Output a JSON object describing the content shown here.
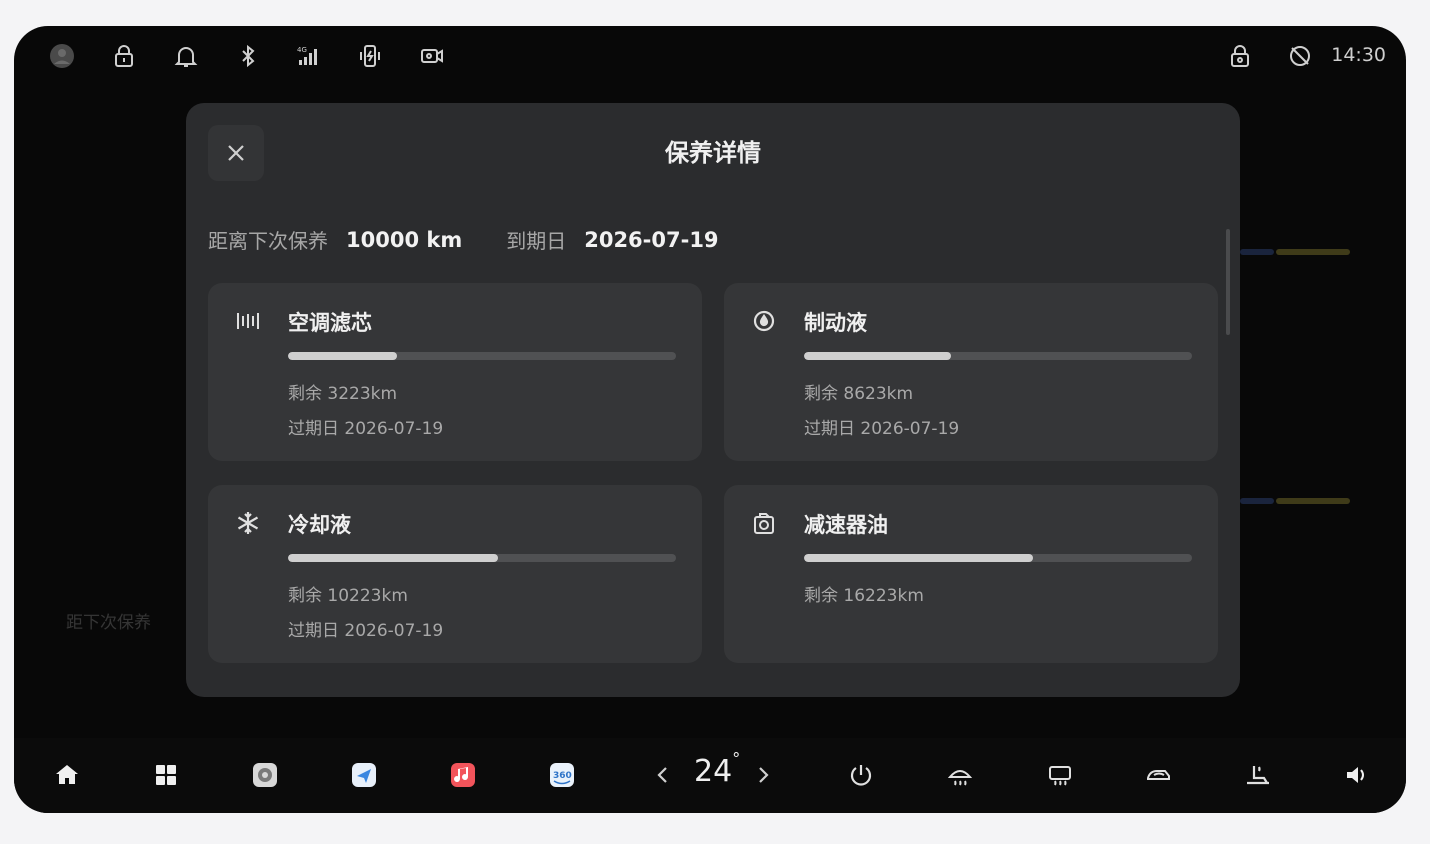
{
  "status_bar": {
    "time": "14:30"
  },
  "background": {
    "next_service_label": "距下次保养"
  },
  "modal": {
    "title": "保养详情",
    "summary": {
      "distance_label": "距离下次保养",
      "distance_value": "10000 km",
      "due_label": "到期日",
      "due_value": "2026-07-19"
    },
    "items": [
      {
        "name": "空调滤芯",
        "icon": "air-filter-icon",
        "remain": "剩余 3223km",
        "expire": "过期日 2026-07-19",
        "progress": 0.28
      },
      {
        "name": "制动液",
        "icon": "brake-fluid-icon",
        "remain": "剩余 8623km",
        "expire": "过期日 2026-07-19",
        "progress": 0.38
      },
      {
        "name": "冷却液",
        "icon": "coolant-icon",
        "remain": "剩余 10223km",
        "expire": "过期日 2026-07-19",
        "progress": 0.54
      },
      {
        "name": "减速器油",
        "icon": "gear-oil-icon",
        "remain": "剩余 16223km",
        "expire": "",
        "progress": 0.59
      }
    ]
  },
  "dock": {
    "temperature": "24"
  },
  "colors": {
    "modal_bg": "#2b2c2e",
    "card_bg": "#353638",
    "progress_fill": "#cfcfcf",
    "accent_yellow": "#a79a3a",
    "accent_blue": "#3b5aa0"
  }
}
